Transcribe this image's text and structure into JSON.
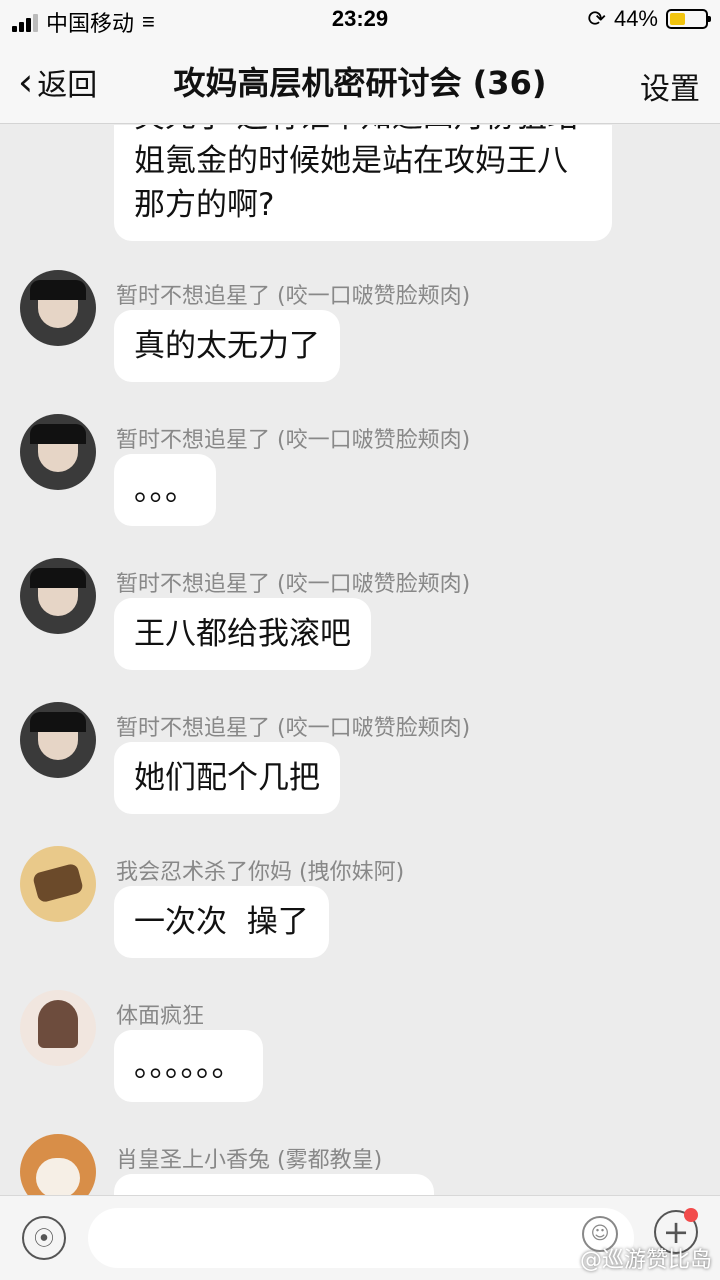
{
  "status": {
    "carrier": "中国移动",
    "time": "23:29",
    "battery": "44%"
  },
  "nav": {
    "back_label": "返回",
    "title": "攻妈高层机密研讨会 (36)",
    "settings_label": "设置"
  },
  "messages": [
    {
      "sender": "",
      "text_lines": [
        "笑死了 还有谁不知道四月份狙站",
        "姐氪金的时候她是站在攻妈王八",
        "那方的啊?"
      ]
    },
    {
      "sender": "暂时不想追星了 (咬一口啵赞脸颊肉)",
      "text": "真的太无力了"
    },
    {
      "sender": "暂时不想追星了 (咬一口啵赞脸颊肉)",
      "text": "。。。"
    },
    {
      "sender": "暂时不想追星了 (咬一口啵赞脸颊肉)",
      "text": "王八都给我滚吧"
    },
    {
      "sender": "暂时不想追星了 (咬一口啵赞脸颊肉)",
      "text": "她们配个几把"
    },
    {
      "sender": "我会忍术杀了你妈 (拽你妹阿)",
      "text": "一次次  操了"
    },
    {
      "sender": "体面疯狂",
      "text": "。。。。。。"
    },
    {
      "sender": "肖皇圣上小香兔 (雾都教皇)",
      "text": ""
    }
  ],
  "input": {
    "watermark": "@巡游赞比岛"
  },
  "colors": {
    "background": "#ececec",
    "bubble": "#ffffff",
    "badge": "#f24b4b",
    "battery_fill": "#f1c40f"
  }
}
